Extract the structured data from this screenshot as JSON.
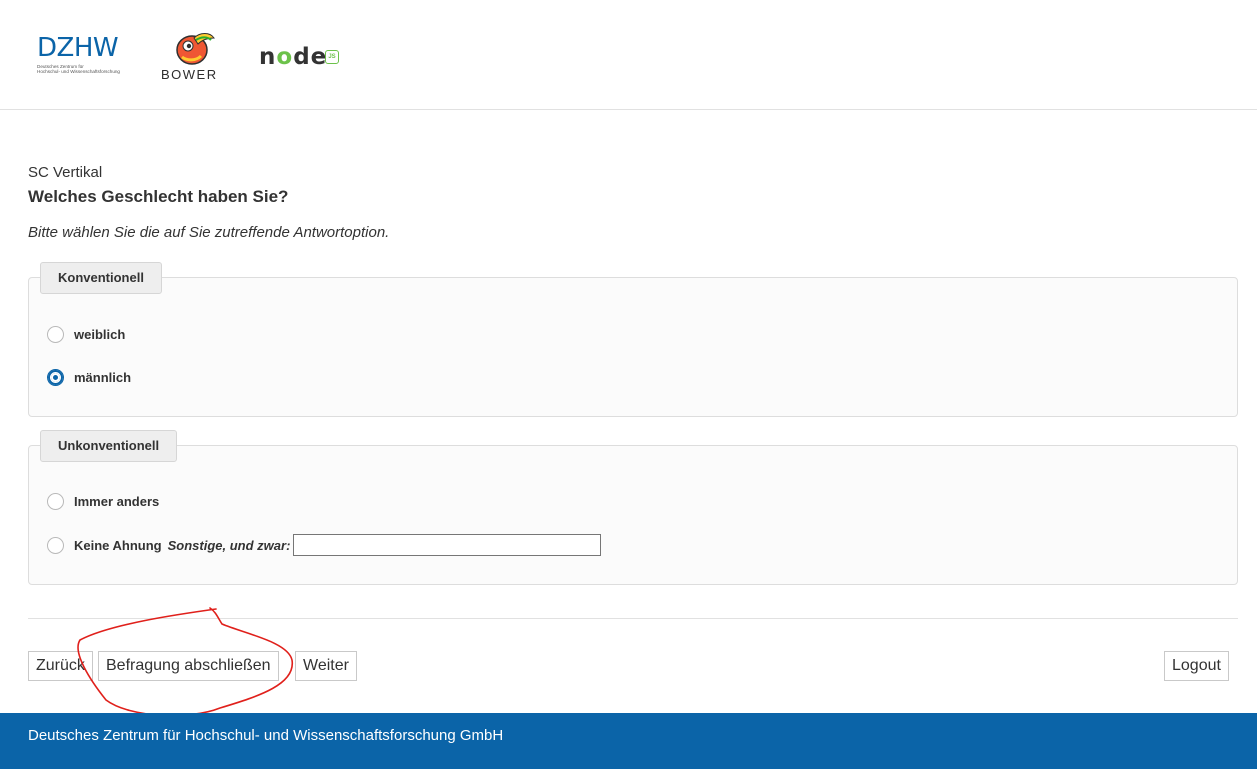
{
  "header": {
    "logos": {
      "dzhw": {
        "mark": "DZHW",
        "subtitle_line1": "Deutsches Zentrum für",
        "subtitle_line2": "Hochschul- und Wissenschaftsforschung"
      },
      "bower": {
        "wordmark": "BOWER"
      },
      "node": {
        "wordmark_n": "n",
        "wordmark_o": "o",
        "wordmark_de": "de",
        "badge": "JS"
      }
    }
  },
  "question": {
    "reference": "SC Vertikal",
    "title": "Welches Geschlecht haben Sie?",
    "instruction": "Bitte wählen Sie die auf Sie zutreffende Antwortoption."
  },
  "groups": [
    {
      "legend": "Konventionell",
      "options": [
        {
          "label": "weiblich",
          "checked": false
        },
        {
          "label": "männlich",
          "checked": true
        }
      ]
    },
    {
      "legend": "Unkonventionell",
      "options": [
        {
          "label": "Immer anders",
          "checked": false
        },
        {
          "label": "Keine Ahnung",
          "checked": false,
          "other_label": "Sonstige, und zwar:",
          "other_value": ""
        }
      ]
    }
  ],
  "buttons": {
    "back": "Zurück",
    "finish": "Befragung abschließen",
    "next": "Weiter",
    "logout": "Logout"
  },
  "footer": {
    "text": "Deutsches Zentrum für Hochschul- und Wissenschaftsforschung GmbH"
  },
  "colors": {
    "brand": "#0b64a8",
    "annotation": "#e0201b",
    "node_green": "#6cc24a"
  }
}
